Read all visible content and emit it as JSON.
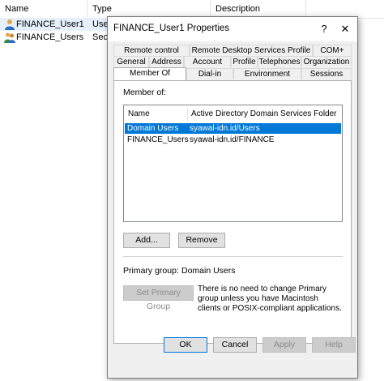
{
  "background": {
    "columns": [
      "Name",
      "Type",
      "Description"
    ],
    "rows": [
      {
        "name": "FINANCE_User1",
        "type": "User",
        "icon": "user-icon"
      },
      {
        "name": "FINANCE_Users",
        "type": "Secu",
        "icon": "group-icon"
      }
    ]
  },
  "dialog": {
    "title": "FINANCE_User1 Properties",
    "help_label": "?",
    "close_label": "✕",
    "tabs": {
      "remote_control": "Remote control",
      "rds_profile": "Remote Desktop Services Profile",
      "com_plus": "COM+",
      "general": "General",
      "address": "Address",
      "account": "Account",
      "profile": "Profile",
      "telephones": "Telephones",
      "organization": "Organization",
      "member_of": "Member Of",
      "dial_in": "Dial-in",
      "environment": "Environment",
      "sessions": "Sessions"
    },
    "member_of_label": "Member of:",
    "list_headers": [
      "Name",
      "Active Directory Domain Services Folder"
    ],
    "members": [
      {
        "name": "Domain Users",
        "folder": "syawal-idn.id/Users"
      },
      {
        "name": "FINANCE_Users",
        "folder": "syawal-idn.id/FINANCE"
      }
    ],
    "add_label": "Add...",
    "remove_label": "Remove",
    "primary_group_label": "Primary group:",
    "primary_group_value": "Domain Users",
    "set_primary_label": "Set Primary Group",
    "note": "There is no need to change Primary group unless you have Macintosh clients or POSIX-compliant applications.",
    "ok_label": "OK",
    "cancel_label": "Cancel",
    "apply_label": "Apply",
    "help_button_label": "Help"
  },
  "colors": {
    "selection": "#0078d7",
    "dialog_bg": "#f0f0f0",
    "row_hover": "#e5f0fb"
  }
}
